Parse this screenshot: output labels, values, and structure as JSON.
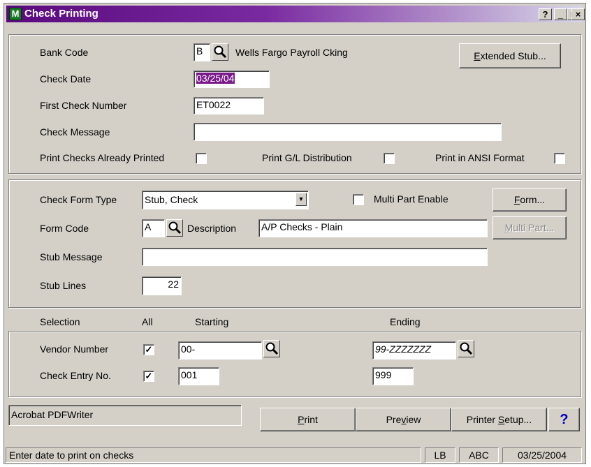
{
  "window": {
    "title": "Check Printing",
    "help_btn": "?",
    "min_btn": "_",
    "max_btn": "□",
    "close_btn": "×"
  },
  "top": {
    "bank_code_label": "Bank Code",
    "bank_code_value": "B",
    "bank_name": "Wells Fargo Payroll Cking",
    "extended_stub_pre": "",
    "extended_stub_ul": "E",
    "extended_stub_post": "xtended Stub...",
    "check_date_label": "Check Date",
    "check_date_value": "03/25/04",
    "first_check_label": "First Check Number",
    "first_check_value": "ET0022",
    "check_message_label": "Check Message",
    "check_message_value": "",
    "print_already_label": "Print Checks Already Printed",
    "print_gl_label": "Print G/L Distribution",
    "print_ansi_label": "Print in ANSI Format",
    "print_already_checked": false,
    "print_gl_checked": false,
    "print_ansi_checked": false
  },
  "form": {
    "type_label": "Check Form Type",
    "type_value": "Stub, Check",
    "multipart_label": "Multi Part Enable",
    "multipart_checked": false,
    "form_btn_ul": "F",
    "form_btn_post": "orm...",
    "form_code_label": "Form Code",
    "form_code_value": "A",
    "description_label": "Description",
    "description_value": "A/P Checks - Plain",
    "multipart_btn_ul": "M",
    "multipart_btn_post": "ulti Part...",
    "stub_message_label": "Stub Message",
    "stub_message_value": "",
    "stub_lines_label": "Stub Lines",
    "stub_lines_value": "22"
  },
  "selection": {
    "header_selection": "Selection",
    "header_all": "All",
    "header_starting": "Starting",
    "header_ending": "Ending",
    "vendor_label": "Vendor Number",
    "vendor_all_mark": "✓",
    "vendor_start": "00-",
    "vendor_end": "99-ZZZZZZZ",
    "entry_label": "Check Entry No.",
    "entry_all_mark": "✓",
    "entry_start": "001",
    "entry_end": "999"
  },
  "bottom": {
    "printer_name": "Acrobat PDFWriter",
    "print_ul": "P",
    "print_post": "rint",
    "preview_pre": "Pre",
    "preview_ul": "v",
    "preview_post": "iew",
    "setup_pre": "Printer ",
    "setup_ul": "S",
    "setup_post": "etup...",
    "help_label": "?"
  },
  "status": {
    "message": "Enter date to print on checks",
    "user": "LB",
    "company": "ABC",
    "date": "03/25/2004"
  },
  "colors": {
    "title_start": "#5a0a7e",
    "selection_highlight": "#7a1a8a",
    "help_blue": "#0000c0"
  },
  "icons": {
    "lookup": "magnifier-icon",
    "dropdown": "dropdown-arrow-icon",
    "app": "app-m-icon"
  }
}
